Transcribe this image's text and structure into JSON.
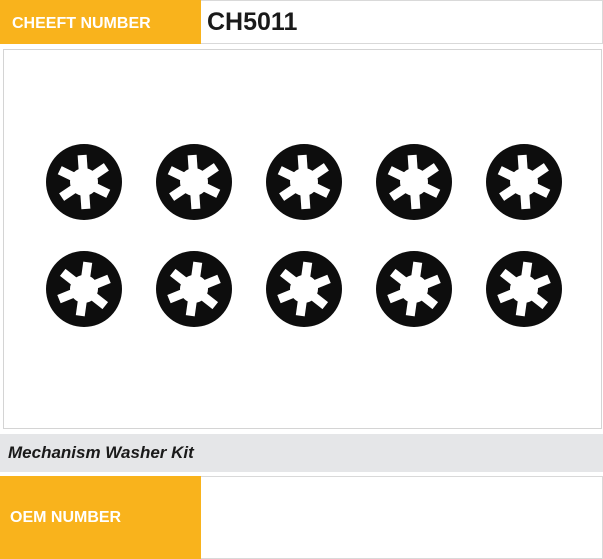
{
  "product": {
    "cheeft_label": "CHEEFT NUMBER",
    "cheeft_number": "CH5011",
    "description": "Mechanism Washer Kit",
    "oem_label": "OEM NUMBER",
    "oem_number": ""
  },
  "image": {
    "subject": "starlock washers",
    "rows": 2,
    "columns": 5,
    "washer_color": "#0d0d0d"
  },
  "colors": {
    "accent": "#F9B31C",
    "description_bar": "#E5E6E8"
  }
}
